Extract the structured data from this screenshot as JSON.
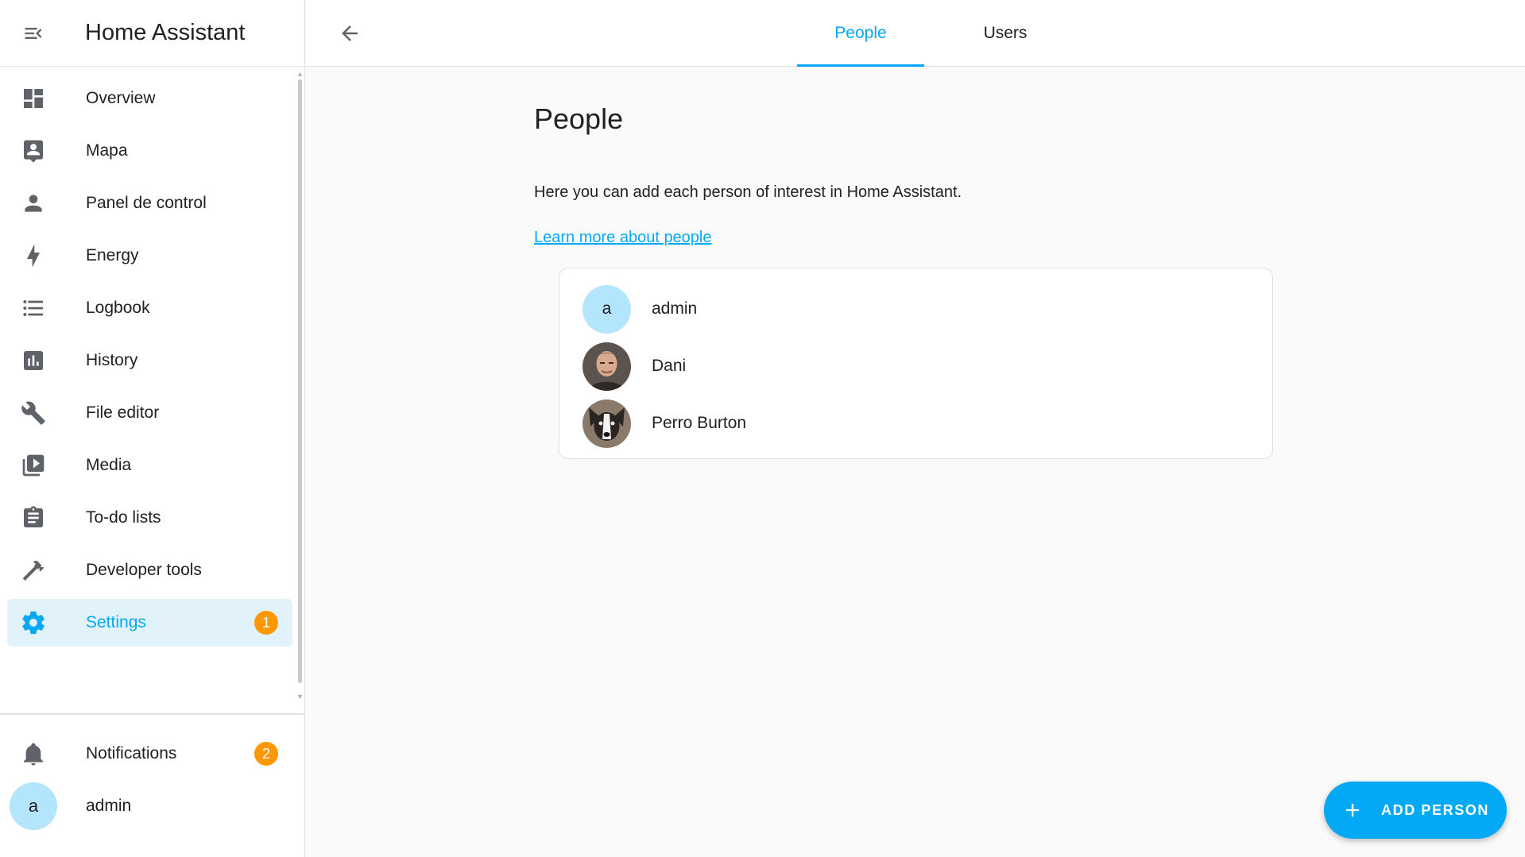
{
  "sidebar": {
    "title": "Home Assistant",
    "items": [
      {
        "label": "Overview",
        "icon": "dashboard-icon"
      },
      {
        "label": "Mapa",
        "icon": "map-account-icon"
      },
      {
        "label": "Panel de control",
        "icon": "person-icon"
      },
      {
        "label": "Energy",
        "icon": "lightning-bolt-icon"
      },
      {
        "label": "Logbook",
        "icon": "format-list-icon"
      },
      {
        "label": "History",
        "icon": "chart-box-icon"
      },
      {
        "label": "File editor",
        "icon": "wrench-icon"
      },
      {
        "label": "Media",
        "icon": "play-box-multiple-icon"
      },
      {
        "label": "To-do lists",
        "icon": "clipboard-list-icon"
      },
      {
        "label": "Developer tools",
        "icon": "hammer-icon"
      },
      {
        "label": "Settings",
        "icon": "cog-icon",
        "badge": "1",
        "active": true
      }
    ],
    "notifications": {
      "label": "Notifications",
      "badge": "2"
    },
    "user": {
      "initial": "a",
      "name": "admin"
    }
  },
  "tabs": [
    {
      "label": "People",
      "active": true
    },
    {
      "label": "Users",
      "active": false
    }
  ],
  "main": {
    "title": "People",
    "description": "Here you can add each person of interest in Home Assistant.",
    "learn_more": "Learn more about people",
    "people": [
      {
        "name": "admin",
        "initial": "a"
      },
      {
        "name": "Dani"
      },
      {
        "name": "Perro Burton"
      }
    ]
  },
  "fab": {
    "label": "ADD PERSON"
  },
  "colors": {
    "accent": "#03a9f4",
    "badge": "#ff9800",
    "active_bg": "#e1f2fb",
    "avatar_bg": "#b3e5fc"
  }
}
